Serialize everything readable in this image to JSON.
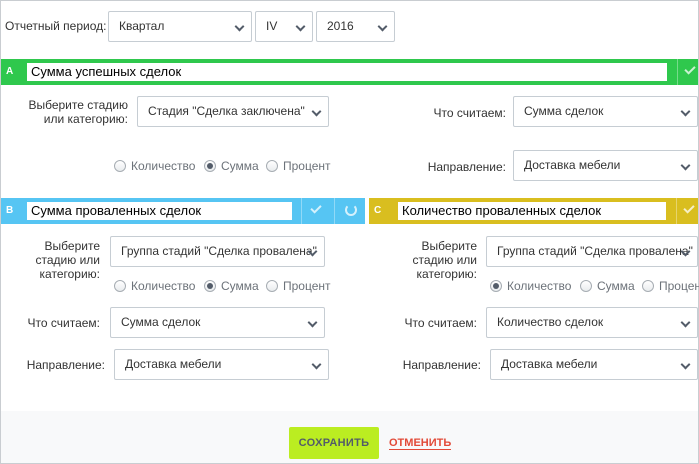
{
  "period": {
    "label": "Отчетный период:",
    "type_value": "Квартал",
    "quarter_value": "IV",
    "year_value": "2016"
  },
  "block_a": {
    "letter": "A",
    "title": "Сумма успешных сделок",
    "color": "#2fc84d",
    "stage_label": "Выберите стадию или категорию:",
    "stage_value": "Стадия \"Сделка заключена\"",
    "count_label": "Что считаем:",
    "count_value": "Сумма сделок",
    "direction_label": "Направление:",
    "direction_value": "Доставка мебели",
    "radio": {
      "quantity": "Количество",
      "sum": "Сумма",
      "percent": "Процент",
      "selected": "sum"
    }
  },
  "block_b": {
    "letter": "B",
    "title": "Сумма проваленных сделок",
    "color": "#56c5f3",
    "stage_label": "Выберите стадию или категорию:",
    "stage_value": "Группа стадий \"Сделка провалена\"",
    "count_label": "Что считаем:",
    "count_value": "Сумма сделок",
    "direction_label": "Направление:",
    "direction_value": "Доставка мебели",
    "radio": {
      "quantity": "Количество",
      "sum": "Сумма",
      "percent": "Процент",
      "selected": "sum"
    }
  },
  "block_c": {
    "letter": "C",
    "title": "Количество проваленных сделок",
    "color": "#d9be1f",
    "stage_label": "Выберите стадию или категорию:",
    "stage_value": "Группа стадий \"Сделка провалена\"",
    "count_label": "Что считаем:",
    "count_value": "Количество сделок",
    "direction_label": "Направление:",
    "direction_value": "Доставка мебели",
    "radio": {
      "quantity": "Количество",
      "sum": "Сумма",
      "percent": "Процент",
      "selected": "quantity"
    }
  },
  "footer": {
    "save_label": "СОХРАНИТЬ",
    "cancel_label": "ОТМЕНИТЬ"
  }
}
